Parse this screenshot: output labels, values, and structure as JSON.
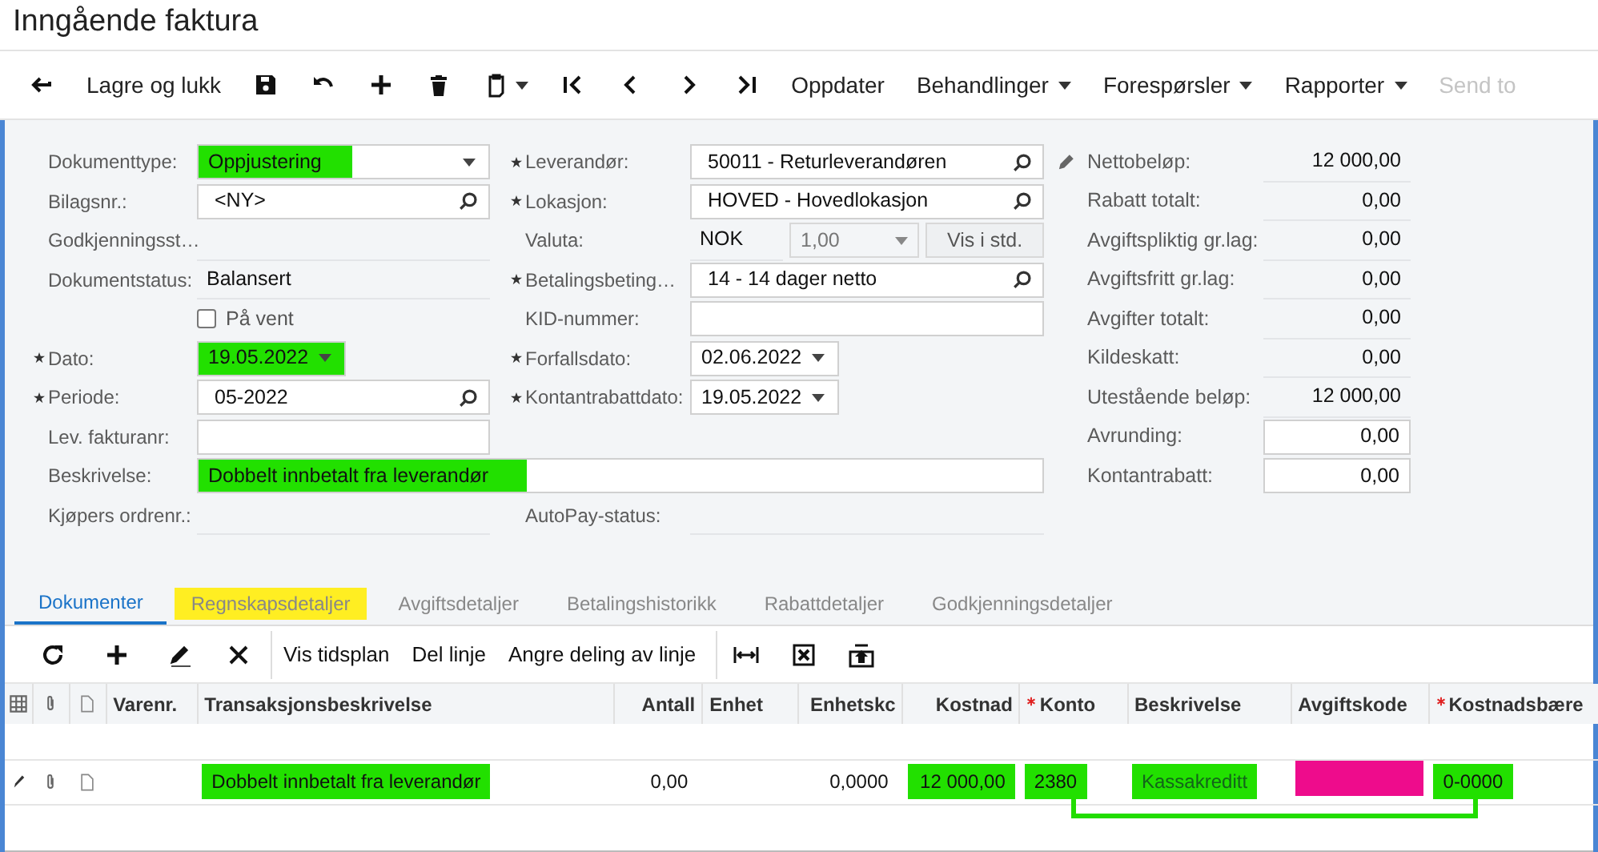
{
  "title": "Inngående faktura",
  "toolbar": [
    {
      "label": "Lagre og lukk",
      "kind": "button",
      "disabled": false
    },
    {
      "label": "Oppdater",
      "kind": "button",
      "disabled": false
    },
    {
      "label": "Behandlinger",
      "kind": "menu",
      "disabled": false
    },
    {
      "label": "Forespørsler",
      "kind": "menu",
      "disabled": false
    },
    {
      "label": "Rapporter",
      "kind": "menu",
      "disabled": false
    },
    {
      "label": "Send to",
      "kind": "button",
      "disabled": true
    }
  ],
  "form": {
    "left": [
      {
        "label": "Dokumenttype:",
        "kind": "select",
        "value": "Oppjustering",
        "color": "#22e000",
        "required": false
      },
      {
        "label": "Bilagsnr.:",
        "kind": "lookup",
        "value": "<NY>",
        "required": false
      },
      {
        "label": "Godkjenningsst…",
        "kind": "readonly",
        "required": false
      },
      {
        "label": "Dokumentstatus:",
        "kind": "readonly",
        "value": "Balansert",
        "required": false
      },
      {
        "label": "På vent",
        "kind": "checkbox",
        "checked": false
      },
      {
        "label": "Dato:",
        "kind": "date",
        "value": "19.05.2022",
        "color": "#22e000",
        "required": true
      },
      {
        "label": "Periode:",
        "kind": "lookup",
        "value": "05-2022",
        "required": true
      },
      {
        "label": "Lev. fakturanr:",
        "kind": "text",
        "required": false
      },
      {
        "label": "Beskrivelse:",
        "kind": "wide",
        "value": "Dobbelt innbetalt fra leverandør",
        "color": "#22e000",
        "required": false
      },
      {
        "label": "Kjøpers ordrenr.:",
        "kind": "readonly",
        "required": false
      }
    ],
    "middle": [
      {
        "label": "Leverandør:",
        "kind": "lookup",
        "value": "50011 - Returleverandøren",
        "required": true
      },
      {
        "label": "Lokasjon:",
        "kind": "lookup",
        "value": "HOVED - Hovedlokasjon",
        "required": true
      },
      {
        "label": "Valuta:",
        "kind": "currency",
        "value": "NOK",
        "rate": "1,00",
        "button": "Vis i std.",
        "required": false
      },
      {
        "label": "Betalingsbeting…",
        "kind": "lookup",
        "value": "14 - 14 dager netto",
        "required": true
      },
      {
        "label": "KID-nummer:",
        "kind": "text",
        "required": false
      },
      {
        "label": "Forfallsdato:",
        "kind": "date",
        "value": "02.06.2022",
        "required": true
      },
      {
        "label": "Kontantrabattdato:",
        "kind": "date",
        "value": "19.05.2022",
        "required": true
      },
      {
        "label": "AutoPay-status:",
        "kind": "readonly",
        "required": false
      }
    ],
    "right": [
      {
        "label": "Nettobeløp:",
        "kind": "amount",
        "value": "12 000,00"
      },
      {
        "label": "Rabatt totalt:",
        "kind": "amount",
        "value": "0,00"
      },
      {
        "label": "Avgiftspliktig gr.lag:",
        "kind": "amount",
        "value": "0,00"
      },
      {
        "label": "Avgiftsfritt gr.lag:",
        "kind": "amount",
        "value": "0,00"
      },
      {
        "label": "Avgifter totalt:",
        "kind": "amount",
        "value": "0,00"
      },
      {
        "label": "Kildeskatt:",
        "kind": "amount",
        "value": "0,00"
      },
      {
        "label": "Utestående beløp:",
        "kind": "amount",
        "value": "12 000,00"
      },
      {
        "label": "Avrunding:",
        "kind": "input",
        "value": "0,00"
      },
      {
        "label": "Kontantrabatt:",
        "kind": "input",
        "value": "0,00"
      }
    ]
  },
  "tabs": [
    {
      "label": "Dokumenter",
      "selected": true
    },
    {
      "label": "Regnskapsdetaljer",
      "selected": false,
      "color": "#ffee22"
    },
    {
      "label": "Avgiftsdetaljer",
      "selected": false
    },
    {
      "label": "Betalingshistorikk",
      "selected": false
    },
    {
      "label": "Rabattdetaljer",
      "selected": false
    },
    {
      "label": "Godkjenningsdetaljer",
      "selected": false
    }
  ],
  "grid_toolbar": [
    "Vis tidsplan",
    "Del linje",
    "Angre deling av linje"
  ],
  "table": {
    "columns": [
      {
        "label": "Varenr.",
        "required": false
      },
      {
        "label": "Transaksjonsbeskrivelse",
        "required": false
      },
      {
        "label": "Antall",
        "required": false
      },
      {
        "label": "Enhet",
        "required": false
      },
      {
        "label": "Enhetskc",
        "required": false
      },
      {
        "label": "Kostnad",
        "required": false
      },
      {
        "label": "Konto",
        "required": true
      },
      {
        "label": "Beskrivelse",
        "required": false
      },
      {
        "label": "Avgiftskode",
        "required": false
      },
      {
        "label": "Kostnadsbære",
        "required": true
      }
    ],
    "rows": [
      {
        "cells": [
          {},
          {
            "value": "Dobbelt innbetalt fra leverandør",
            "color": "#22e000"
          },
          {
            "value": "0,00"
          },
          {},
          {
            "value": "0,0000"
          },
          {
            "value": "12 000,00",
            "color": "#22e000"
          },
          {
            "value": "2380",
            "color": "#22e000"
          },
          {
            "value": "Kassakreditt",
            "color": "#22e000",
            "faded": true
          },
          {
            "color": "#ee0c8c"
          },
          {
            "value": "0-0000",
            "color": "#22e000"
          }
        ]
      }
    ]
  }
}
